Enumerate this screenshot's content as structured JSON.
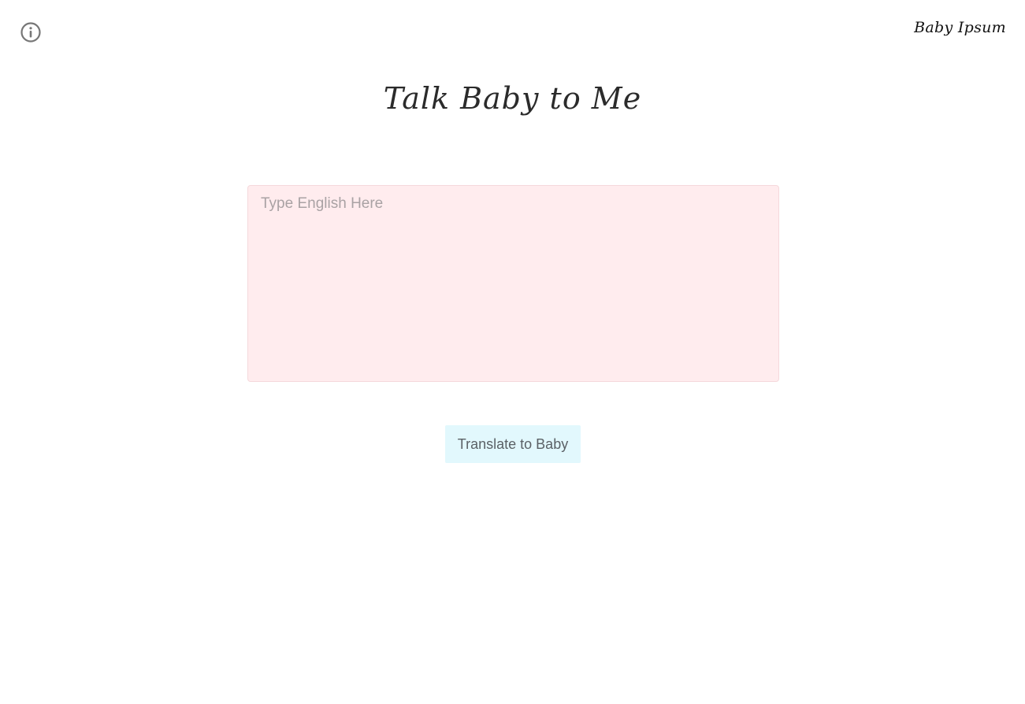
{
  "header": {
    "info_icon": "info-circle-icon",
    "brand_link": "Baby Ipsum"
  },
  "main": {
    "title": "Talk Baby to Me",
    "input": {
      "value": "",
      "placeholder": "Type English Here"
    },
    "translate_button": "Translate to Baby"
  },
  "colors": {
    "textarea_bg": "#ffecee",
    "button_bg": "#e2f8fd",
    "icon_gray": "#777777"
  }
}
